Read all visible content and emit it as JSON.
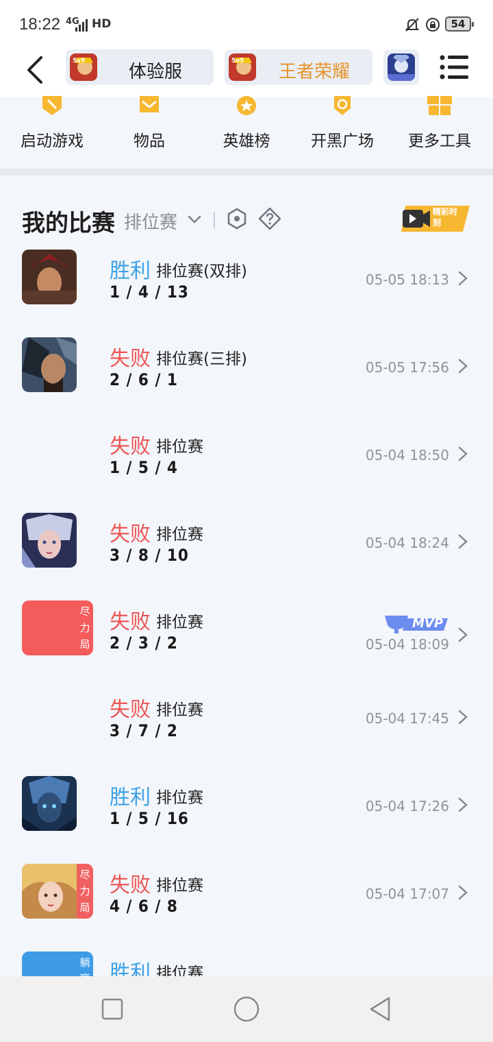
{
  "status_bar": {
    "time": "18:22",
    "network": "4G",
    "hd": "HD",
    "battery": "54"
  },
  "top_bar": {
    "tabs": [
      {
        "label": "体验服",
        "color": "#222222"
      },
      {
        "label": "王者荣耀",
        "color": "#e6932b"
      },
      {
        "label": ""
      }
    ]
  },
  "tools": [
    {
      "label": "启动游戏",
      "icon": "game-controller-icon"
    },
    {
      "label": "物品",
      "icon": "item-icon"
    },
    {
      "label": "英雄榜",
      "icon": "medal-icon"
    },
    {
      "label": "开黑广场",
      "icon": "compass-icon"
    },
    {
      "label": "更多工具",
      "icon": "gift-icon"
    }
  ],
  "matches_header": {
    "title": "我的比赛",
    "filter": "排位赛",
    "highlight_label": "精彩时刻"
  },
  "matches": [
    {
      "result": "胜利",
      "win": true,
      "mode": "排位赛(双排)",
      "kda": "1 / 4 / 13",
      "time": "05-05 18:13",
      "avatar": "hero-1",
      "tag": "",
      "mvp": false
    },
    {
      "result": "失败",
      "win": false,
      "mode": "排位赛(三排)",
      "kda": "2 / 6 / 1",
      "time": "05-05 17:56",
      "avatar": "hero-2",
      "tag": "",
      "mvp": false
    },
    {
      "result": "失败",
      "win": false,
      "mode": "排位赛",
      "kda": "1 / 5 / 4",
      "time": "05-04 18:50",
      "avatar": "",
      "tag": "",
      "mvp": false
    },
    {
      "result": "失败",
      "win": false,
      "mode": "排位赛",
      "kda": "3 / 8 / 10",
      "time": "05-04 18:24",
      "avatar": "hero-3",
      "tag": "",
      "mvp": false
    },
    {
      "result": "失败",
      "win": false,
      "mode": "排位赛",
      "kda": "2 / 3 / 2",
      "time": "05-04 18:09",
      "avatar": "red-block",
      "tag": "尽力局",
      "mvp": true,
      "mvp_label": "MVP"
    },
    {
      "result": "失败",
      "win": false,
      "mode": "排位赛",
      "kda": "3 / 7 / 2",
      "time": "05-04 17:45",
      "avatar": "",
      "tag": "",
      "mvp": false
    },
    {
      "result": "胜利",
      "win": true,
      "mode": "排位赛",
      "kda": "1 / 5 / 16",
      "time": "05-04 17:26",
      "avatar": "hero-4",
      "tag": "",
      "mvp": false
    },
    {
      "result": "失败",
      "win": false,
      "mode": "排位赛",
      "kda": "4 / 6 / 8",
      "time": "05-04 17:07",
      "avatar": "hero-5",
      "tag": "尽力局",
      "mvp": false
    },
    {
      "result": "胜利",
      "win": true,
      "mode": "排位赛",
      "kda": "",
      "time": "",
      "avatar": "blue-block",
      "tag": "躺赢",
      "mvp": false
    }
  ],
  "colors": {
    "win": "#3ea1e6",
    "loss": "#ee5656",
    "accent": "#f7b731"
  }
}
